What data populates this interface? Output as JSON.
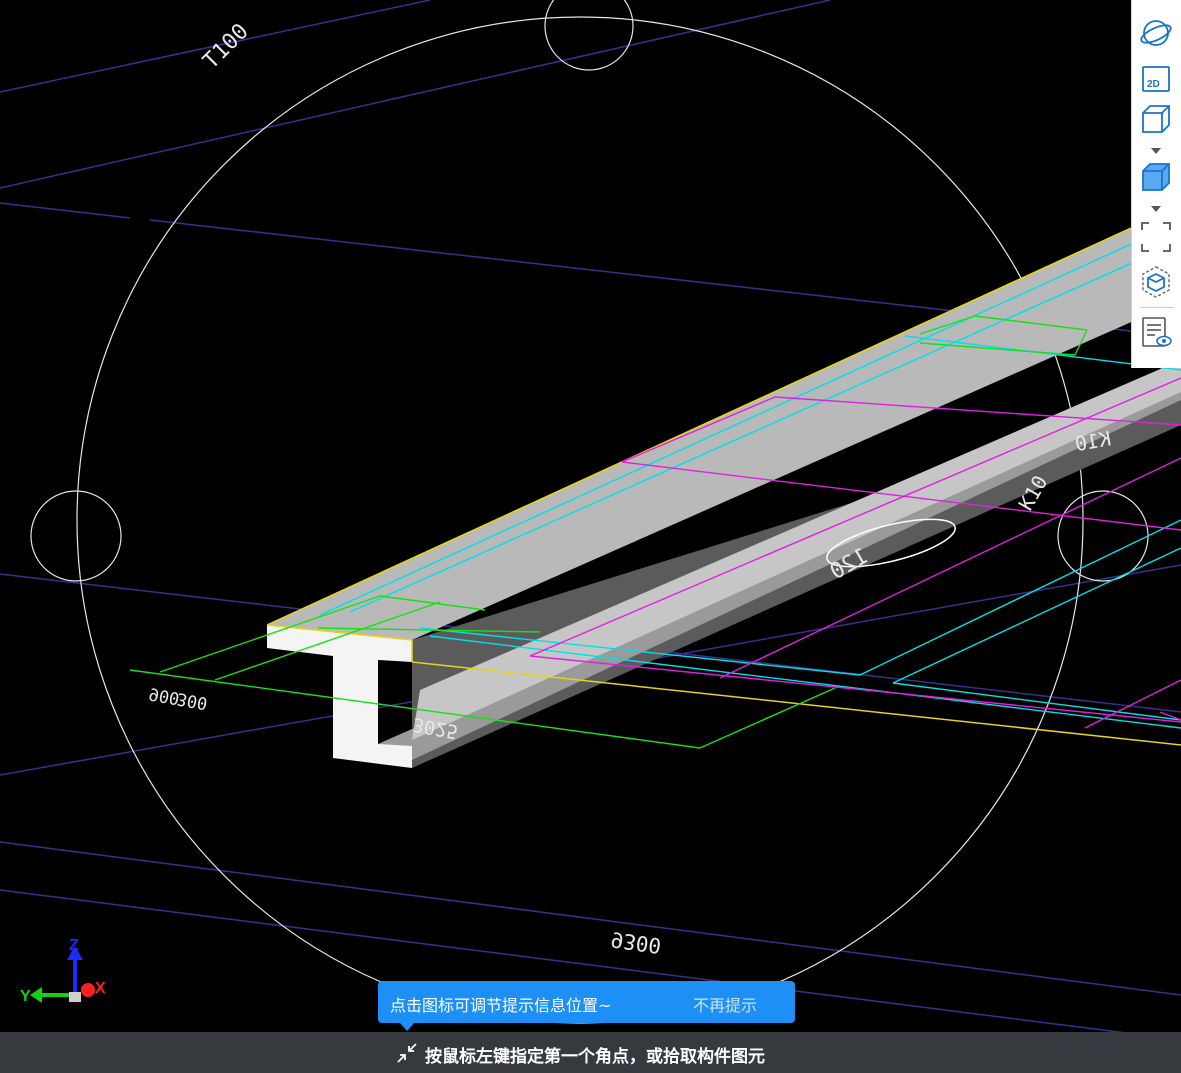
{
  "drawing": {
    "dim_labels": [
      "T100",
      "K10",
      "K10",
      "120",
      "900",
      "300",
      "3025",
      "9300"
    ]
  },
  "axis_gizmo": {
    "x_label": "X",
    "y_label": "Y",
    "z_label": "Z"
  },
  "toolbar": {
    "buttons": [
      {
        "name": "orbit-view-button",
        "icon": "orbit-icon"
      },
      {
        "name": "view-2d-button",
        "icon": "2d-icon",
        "label": "2D"
      },
      {
        "name": "view-3d-wireframe-button",
        "icon": "cube-outline-icon"
      },
      {
        "name": "view-3d-shaded-button",
        "icon": "cube-shaded-icon"
      },
      {
        "name": "zoom-window-button",
        "icon": "dashed-frame-icon"
      },
      {
        "name": "isolate-view-button",
        "icon": "hex-cube-icon"
      },
      {
        "name": "properties-view-button",
        "icon": "list-eye-icon"
      }
    ],
    "accent": "#1a73c9"
  },
  "tip": {
    "text": "点击图标可调节提示信息位置~",
    "dismiss": "不再提示",
    "color": "#1e90f5"
  },
  "status": {
    "text": "按鼠标左键指定第一个角点，或拾取构件图元"
  },
  "colors": {
    "grid_line": "#3a2f8f",
    "cyan": "#00e0e8",
    "magenta": "#e020e0",
    "green": "#18e018",
    "yellow": "#e8d21a",
    "white": "#e8e8e8",
    "beam_top": "#b9b9b9"
  }
}
